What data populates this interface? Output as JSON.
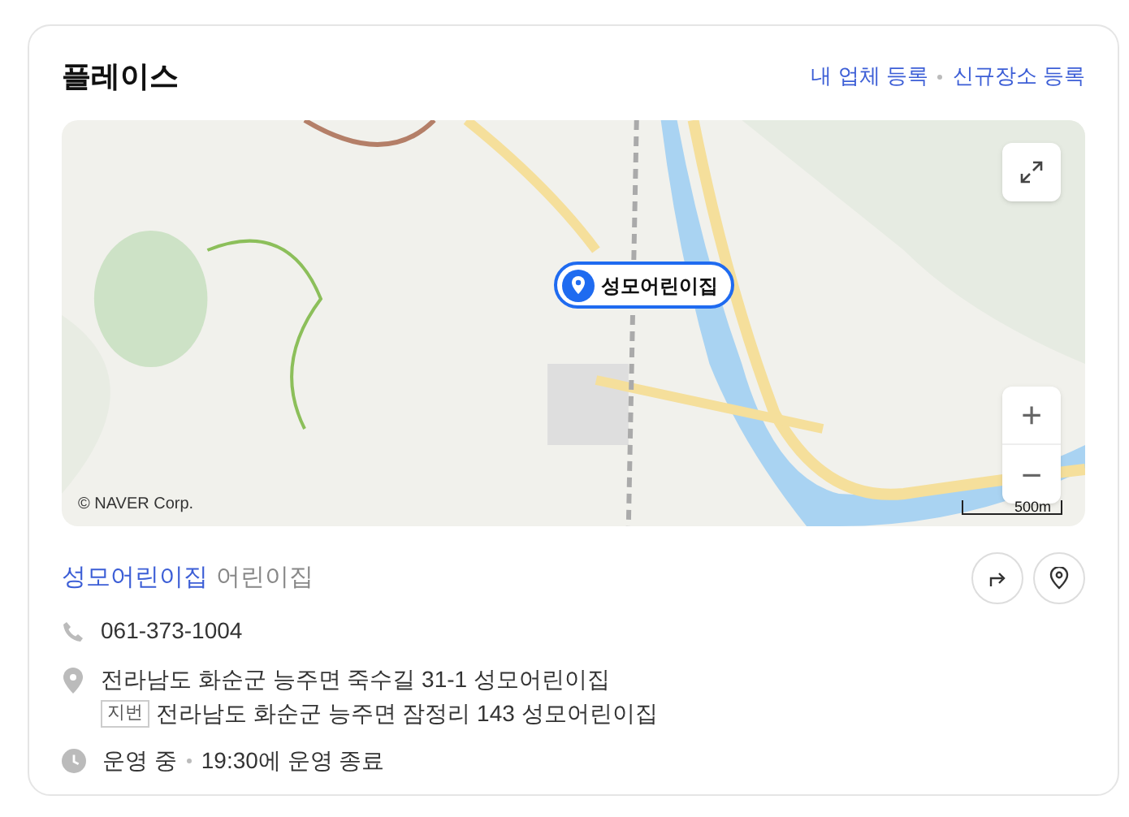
{
  "header": {
    "title": "플레이스",
    "links": [
      "내 업체 등록",
      "신규장소 등록"
    ]
  },
  "map": {
    "marker_label": "성모어린이집",
    "copyright": "© NAVER Corp.",
    "scale": "500m",
    "zoom_in": "+",
    "zoom_out": "−"
  },
  "place": {
    "name": "성모어린이집",
    "category": "어린이집",
    "phone": "061-373-1004",
    "address": "전라남도 화순군 능주면 죽수길 31-1 성모어린이집",
    "lot_badge": "지번",
    "lot_address": "전라남도 화순군 능주면 잠정리 143 성모어린이집",
    "status": "운영 중",
    "hours": "19:30에 운영 종료"
  }
}
